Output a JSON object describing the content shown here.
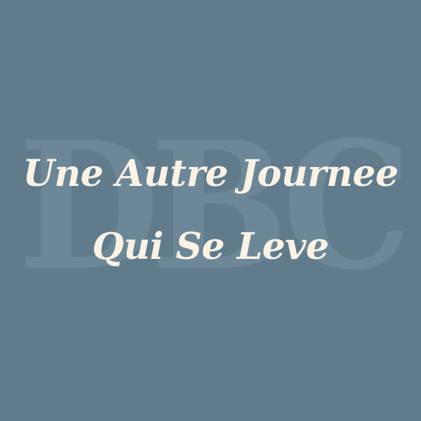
{
  "watermark": {
    "text": "DBC"
  },
  "title": {
    "line1": "Une Autre Journee",
    "line2": "Qui Se Leve"
  },
  "colors": {
    "background": "#5f7b8c",
    "watermark": "#6f8b9b",
    "text": "#fbf2e4"
  }
}
